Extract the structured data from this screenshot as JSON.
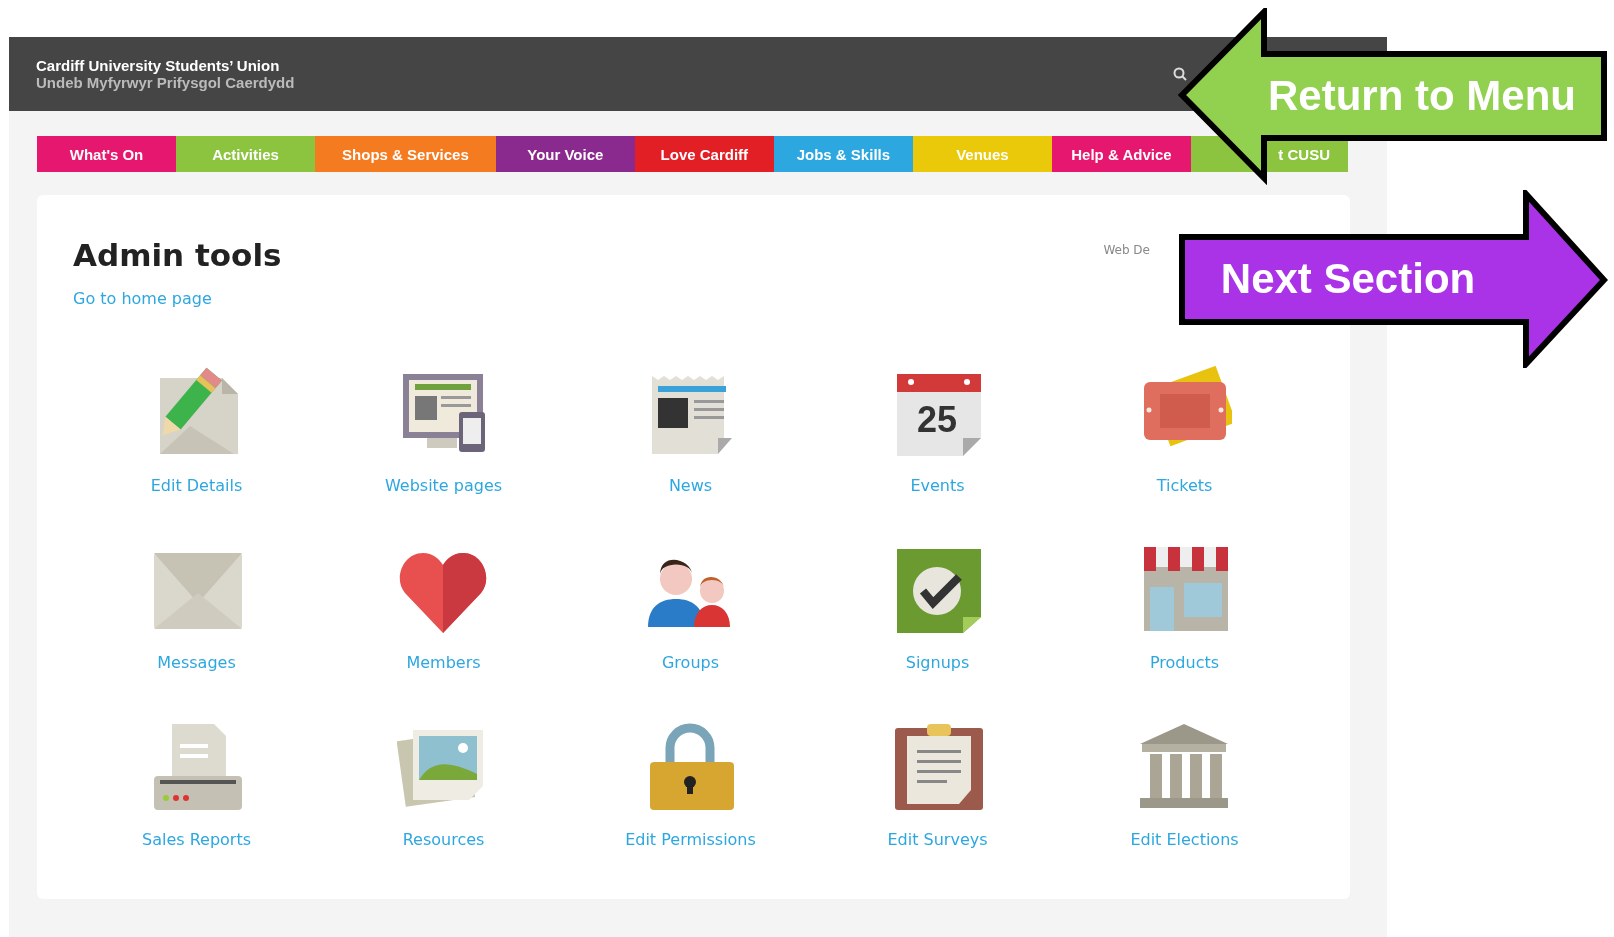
{
  "header": {
    "title": "Cardiff University Students’ Union",
    "subtitle": "Undeb Myfyrwyr Prifysgol Caerdydd"
  },
  "nav": [
    {
      "label": "What's On",
      "color": "#e6176e"
    },
    {
      "label": "Activities",
      "color": "#8cc43f"
    },
    {
      "label": "Shops & Services",
      "color": "#f47b20"
    },
    {
      "label": "Your Voice",
      "color": "#8b2a8e"
    },
    {
      "label": "Love Cardiff",
      "color": "#e31f26"
    },
    {
      "label": "Jobs & Skills",
      "color": "#2da7e0"
    },
    {
      "label": "Venues",
      "color": "#eac80a"
    },
    {
      "label": "Help & Advice",
      "color": "#e6176e"
    },
    {
      "label": "t CUSU",
      "color": "#8cc43f"
    }
  ],
  "page": {
    "title": "Admin tools",
    "home_link": "Go to home page",
    "corner_text": "Web De"
  },
  "tools": [
    {
      "label": "Edit Details",
      "kind": "pencil"
    },
    {
      "label": "Website pages",
      "kind": "screens"
    },
    {
      "label": "News",
      "kind": "newspaper"
    },
    {
      "label": "Events",
      "kind": "calendar",
      "number": "25"
    },
    {
      "label": "Tickets",
      "kind": "tickets"
    },
    {
      "label": "Messages",
      "kind": "envelope"
    },
    {
      "label": "Members",
      "kind": "heart"
    },
    {
      "label": "Groups",
      "kind": "people"
    },
    {
      "label": "Signups",
      "kind": "check"
    },
    {
      "label": "Products",
      "kind": "shop"
    },
    {
      "label": "Sales Reports",
      "kind": "printer"
    },
    {
      "label": "Resources",
      "kind": "photos"
    },
    {
      "label": "Edit Permissions",
      "kind": "padlock"
    },
    {
      "label": "Edit Surveys",
      "kind": "clipboard"
    },
    {
      "label": "Edit Elections",
      "kind": "building"
    }
  ],
  "callouts": [
    {
      "label": "Return to Menu",
      "kind": "back",
      "color": "#92d050"
    },
    {
      "label": "Next Section",
      "kind": "next",
      "color": "#aa33e8"
    }
  ]
}
